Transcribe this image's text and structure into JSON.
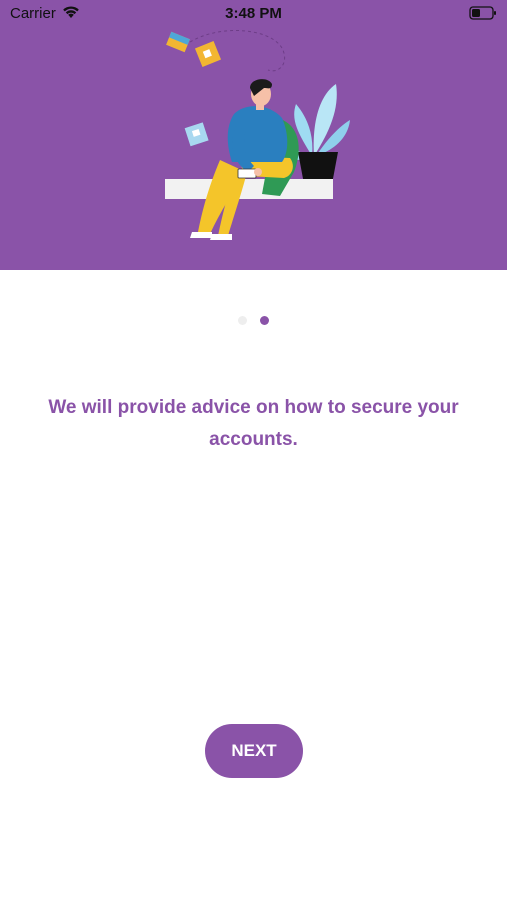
{
  "status_bar": {
    "carrier": "Carrier",
    "time": "3:48 PM",
    "wifi_icon": "wifi-icon",
    "battery_icon": "battery-icon"
  },
  "hero": {
    "background_color": "#8a53a8",
    "illustration": "person-sitting-with-phone-and-plant-illustration"
  },
  "pager": {
    "total_pages": 2,
    "current_page": 2,
    "active_color": "#8a53a8",
    "inactive_color": "#eeeeee"
  },
  "onboarding": {
    "message": "We will provide advice on how to secure your accounts.",
    "next_label": "NEXT"
  }
}
